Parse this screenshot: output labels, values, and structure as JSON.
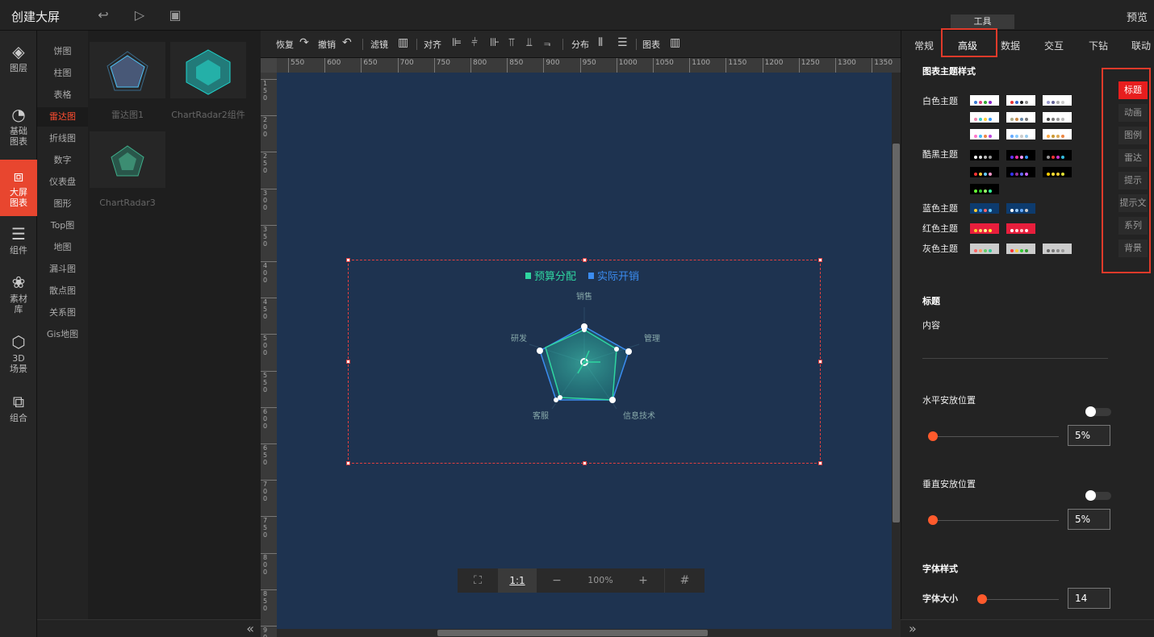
{
  "topbar": {
    "title": "创建大屏",
    "preview": "预览",
    "tool_label": "工具"
  },
  "leftnav": [
    {
      "name": "素材",
      "label": "图层",
      "icon": "layers-icon"
    },
    {
      "label": "基础\n图表",
      "icon": "chart-clock-icon"
    },
    {
      "label": "大屏\n图表",
      "icon": "screen-chart-icon"
    },
    {
      "label": "组件",
      "icon": "sliders-icon"
    },
    {
      "label": "素材\n库",
      "icon": "materials-icon"
    },
    {
      "label": "3D\n场景",
      "icon": "cube-icon"
    },
    {
      "label": "组合",
      "icon": "group-icon"
    }
  ],
  "categories": [
    "饼图",
    "柱图",
    "表格",
    "雷达图",
    "折线图",
    "数字",
    "仪表盘",
    "图形",
    "Top图",
    "地图",
    "漏斗图",
    "散点图",
    "关系图",
    "Gis地图"
  ],
  "thumbs": [
    "雷达图1",
    "ChartRadar2组件",
    "ChartRadar3"
  ],
  "toolbar": {
    "redo": "恢复",
    "undo": "撤销",
    "filter": "滤镜",
    "align": "对齐",
    "distribute": "分布",
    "chart": "图表"
  },
  "ruler_h": [
    "550",
    "600",
    "650",
    "700",
    "750",
    "800",
    "850",
    "900",
    "950",
    "1000",
    "1050",
    "1100",
    "1150",
    "1200",
    "1250",
    "1300",
    "1350"
  ],
  "ruler_v": [
    "150",
    "200",
    "250",
    "300",
    "350",
    "400",
    "450",
    "500",
    "550",
    "600",
    "650",
    "700",
    "750",
    "800",
    "850",
    "900"
  ],
  "chart": {
    "legend": [
      "预算分配",
      "实际开销"
    ],
    "indicators": [
      "销售",
      "管理",
      "信息技术",
      "客服",
      "研发"
    ]
  },
  "zoom": {
    "fit_label": "1:1",
    "value": "100%",
    "minus": "−",
    "plus": "+"
  },
  "right": {
    "tabs": [
      "常规",
      "高级",
      "数据",
      "交互",
      "下钻",
      "联动"
    ],
    "theme_section": "图表主题样式",
    "themes": [
      "白色主题",
      "酷黑主题",
      "蓝色主题",
      "红色主题",
      "灰色主题"
    ],
    "sidetabs": [
      "标题",
      "动画",
      "图例",
      "雷达",
      "提示",
      "提示文",
      "系列",
      "背景"
    ],
    "title_section": "标题",
    "content_label": "内容",
    "h_pos_label": "水平安放位置",
    "h_pos_value": "5%",
    "v_pos_label": "垂直安放位置",
    "v_pos_value": "5%",
    "font_section": "字体样式",
    "font_size_label": "字体大小",
    "font_size_value": "14"
  },
  "colors": {
    "accent": "#e8462f",
    "canvas": "#1e3350",
    "series1": "#2fd6a0",
    "series2": "#3b8cf0"
  }
}
